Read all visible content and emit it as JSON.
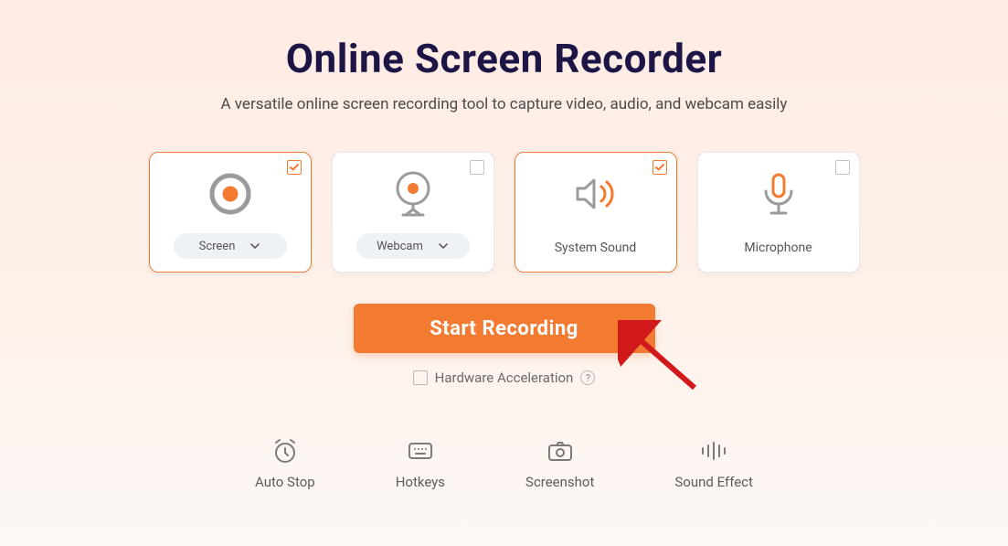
{
  "title": "Online Screen Recorder",
  "subtitle": "A versatile online screen recording tool to capture video, audio, and webcam easily",
  "colors": {
    "accent": "#f37a31",
    "titleInk": "#1d1545"
  },
  "cards": {
    "screen": {
      "label": "Screen",
      "selected": true,
      "dropdown": true
    },
    "webcam": {
      "label": "Webcam",
      "selected": false,
      "dropdown": true
    },
    "sound": {
      "label": "System Sound",
      "selected": true,
      "dropdown": false
    },
    "mic": {
      "label": "Microphone",
      "selected": false,
      "dropdown": false
    }
  },
  "start_label": "Start Recording",
  "hw_accel": {
    "label": "Hardware Acceleration",
    "checked": false
  },
  "tools": {
    "autostop": {
      "label": "Auto Stop"
    },
    "hotkeys": {
      "label": "Hotkeys"
    },
    "screenshot": {
      "label": "Screenshot"
    },
    "soundeffect": {
      "label": "Sound Effect"
    }
  }
}
